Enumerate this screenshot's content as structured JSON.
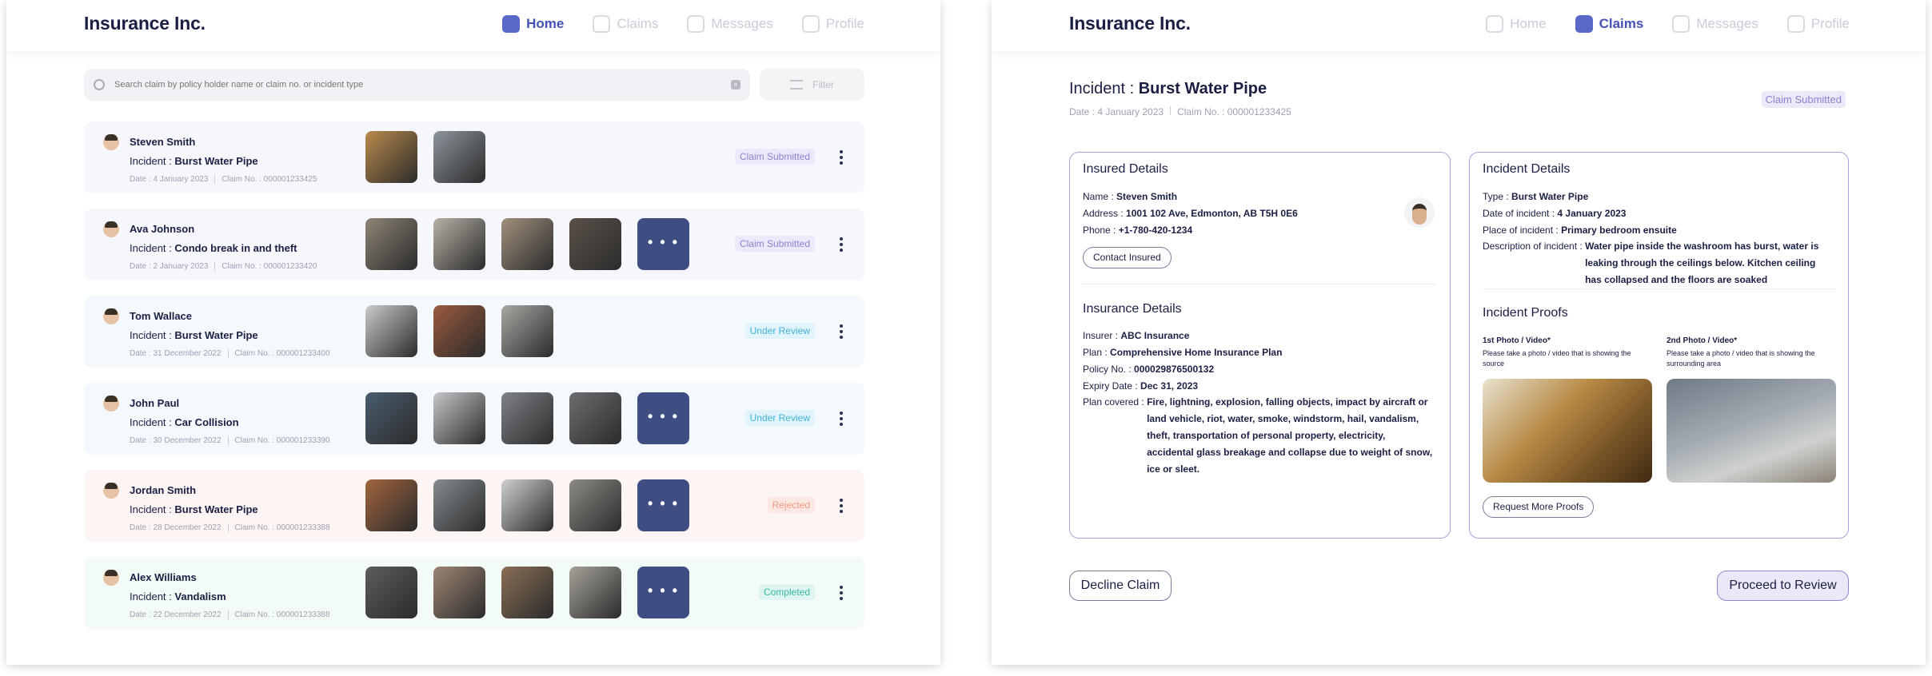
{
  "app": {
    "brand": "Insurance Inc."
  },
  "nav": {
    "home": "Home",
    "claims": "Claims",
    "messages": "Messages",
    "profile": "Profile"
  },
  "list": {
    "search_placeholder": "Search claim by policy holder name or claim no. or incident type",
    "filter_label": "Filter",
    "incident_label": "Incident :",
    "date_label": "Date :",
    "claimno_label": "Claim No. :",
    "more_label": "• • •",
    "claims": [
      {
        "name": "Steven Smith",
        "incident": "Burst Water Pipe",
        "date": "4 January 2023",
        "claim_no": "000001233425",
        "status": "Claim Submitted",
        "tint": "submitted",
        "thumbs": [
          "#b98a4c",
          "#8d959c"
        ],
        "more": false
      },
      {
        "name": "Ava Johnson",
        "incident": "Condo break in and theft",
        "date": "2 January 2023",
        "claim_no": "000001233420",
        "status": "Claim Submitted",
        "tint": "submitted",
        "thumbs": [
          "#8e8475",
          "#b7b0a6",
          "#a1907e",
          "#5b5149"
        ],
        "more": true
      },
      {
        "name": "Tom Wallace",
        "incident": "Burst Water Pipe",
        "date": "31 December 2022",
        "claim_no": "000001233400",
        "status": "Under Review",
        "tint": "review",
        "thumbs": [
          "#c9cbcc",
          "#9a5b3e",
          "#a7a8a3"
        ],
        "more": false
      },
      {
        "name": "John Paul",
        "incident": "Car Collision",
        "date": "30 December 2022",
        "claim_no": "000001233390",
        "status": "Under Review",
        "tint": "review",
        "thumbs": [
          "#4a5d6e",
          "#c6c6c9",
          "#7f8287",
          "#6d6e71"
        ],
        "more": true
      },
      {
        "name": "Jordan Smith",
        "incident": "Burst Water Pipe",
        "date": "28 December 2022",
        "claim_no": "000001233388",
        "status": "Rejected",
        "tint": "rejected",
        "thumbs": [
          "#a0653d",
          "#858b8f",
          "#cfd0ce",
          "#8d8a84"
        ],
        "more": true
      },
      {
        "name": "Alex Williams",
        "incident": "Vandalism",
        "date": "22 December 2022",
        "claim_no": "000001233388",
        "status": "Completed",
        "tint": "completed",
        "thumbs": [
          "#5b5d5e",
          "#9d8674",
          "#8a6f56",
          "#a6a29a"
        ],
        "more": true
      }
    ]
  },
  "detail": {
    "incident_label": "Incident :",
    "incident": "Burst Water Pipe",
    "date_text": "Date : 4 January 2023",
    "claimno_text": "Claim No. : 000001233425",
    "status": "Claim Submitted",
    "insured": {
      "title": "Insured Details",
      "name_k": "Name :",
      "name_v": "Steven Smith",
      "address_k": "Address :",
      "address_v": "1001 102 Ave, Edmonton, AB T5H 0E6",
      "phone_k": "Phone :",
      "phone_v": "+1-780-420-1234",
      "contact_btn": "Contact Insured"
    },
    "insurance": {
      "title": "Insurance Details",
      "insurer_k": "Insurer :",
      "insurer_v": "ABC Insurance",
      "plan_k": "Plan :",
      "plan_v": "Comprehensive Home Insurance Plan",
      "policy_k": "Policy No. :",
      "policy_v": "000029876500132",
      "expiry_k": "Expiry Date :",
      "expiry_v": "Dec 31, 2023",
      "covered_k": "Plan covered :",
      "covered_v": "Fire, lightning, explosion, falling objects, impact by aircraft or land vehicle, riot, water, smoke, windstorm, hail, vandalism, theft, transportation of personal property, electricity, accidental glass breakage and collapse due to weight of snow, ice or sleet."
    },
    "incident_details": {
      "title": "Incident Details",
      "type_k": "Type :",
      "type_v": "Burst Water Pipe",
      "date_k": "Date of incident :",
      "date_v": "4 January 2023",
      "place_k": "Place of incident :",
      "place_v": "Primary bedroom ensuite",
      "desc_k": "Description of incident :",
      "desc_v": "Water pipe inside the washroom has burst, water is leaking through the ceilings below. Kitchen ceiling has collapsed and the floors are soaked"
    },
    "proofs": {
      "title": "Incident Proofs",
      "p1_label": "1st Photo / Video*",
      "p1_hint": "Please take a photo / video that is showing the source",
      "p2_label": "2nd Photo / Video*",
      "p2_hint": "Please take a photo / video that is showing the surrounding area",
      "request_btn": "Request More Proofs"
    },
    "decline_btn": "Decline Claim",
    "proceed_btn": "Proceed to Review"
  }
}
